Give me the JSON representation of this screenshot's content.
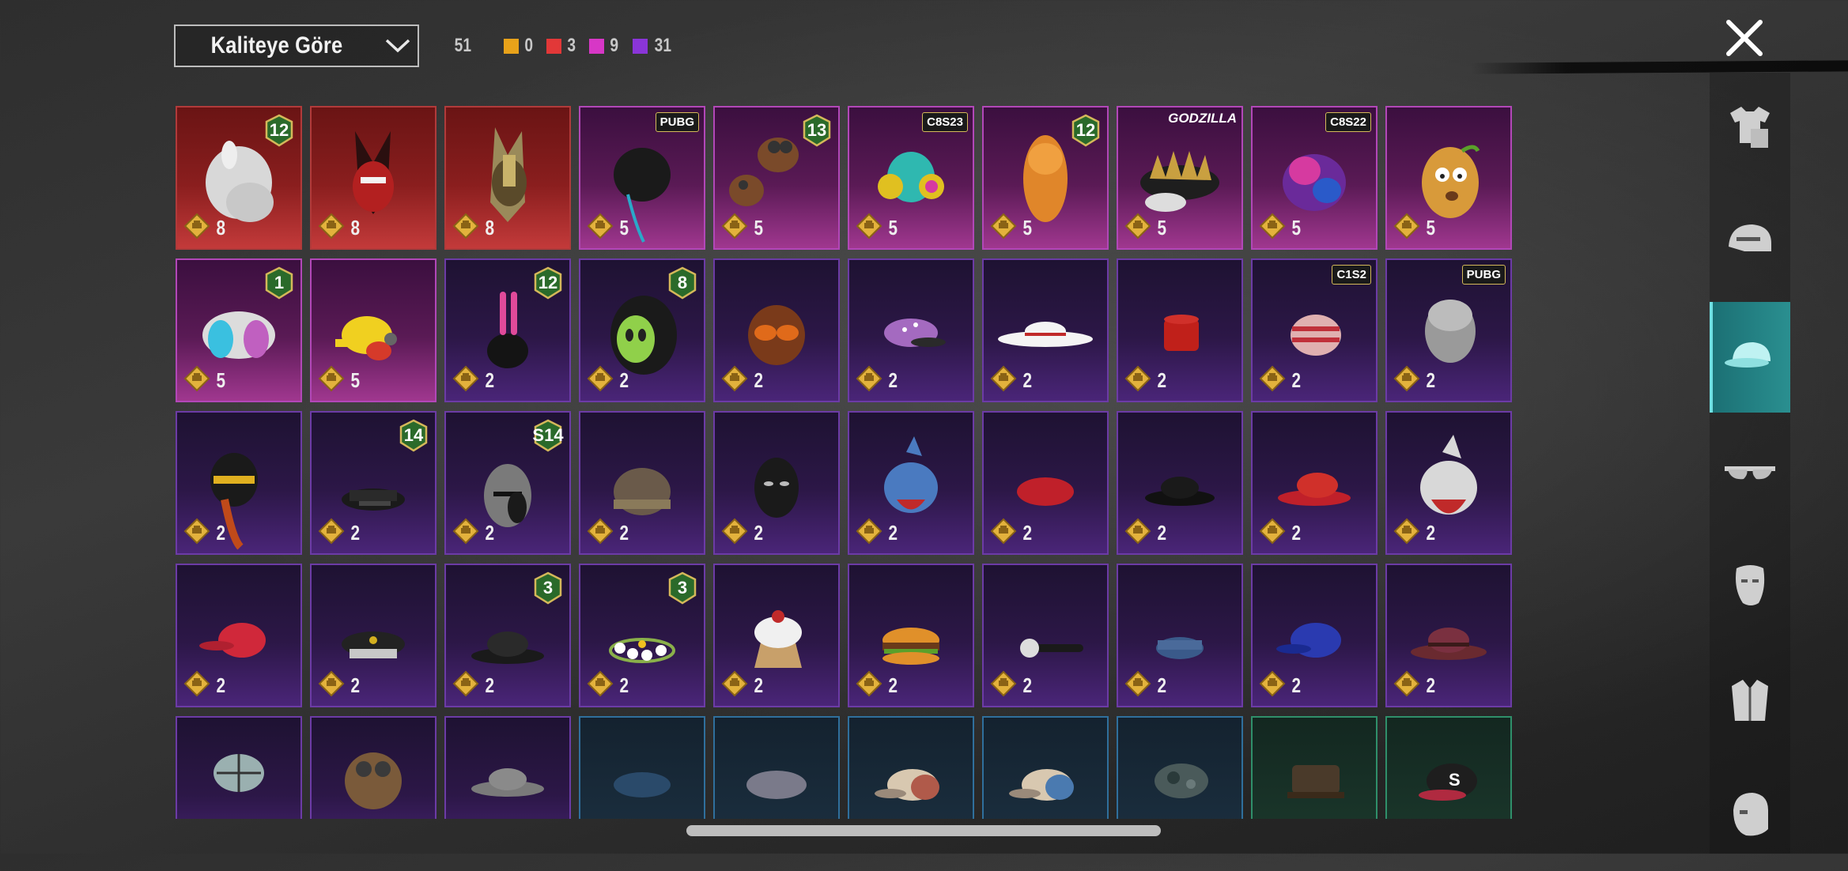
{
  "sort": {
    "label": "Kaliteye Göre"
  },
  "counts": {
    "total": "51",
    "items": [
      {
        "color": "#e8a21a",
        "value": "0"
      },
      {
        "color": "#e23838",
        "value": "3"
      },
      {
        "color": "#d737c6",
        "value": "9"
      },
      {
        "color": "#8a35d8",
        "value": "31"
      }
    ]
  },
  "categories": [
    {
      "name": "outfit-icon",
      "active": false
    },
    {
      "name": "helmet-icon",
      "active": false
    },
    {
      "name": "cap-icon",
      "active": true
    },
    {
      "name": "glasses-icon",
      "active": false
    },
    {
      "name": "mask-icon",
      "active": false
    },
    {
      "name": "jacket-icon",
      "active": false
    },
    {
      "name": "face-icon",
      "active": false
    }
  ],
  "items": [
    {
      "rarity": "legendary",
      "qty": "8",
      "badge": "12",
      "art": "white-hair"
    },
    {
      "rarity": "legendary",
      "qty": "8",
      "badge": "",
      "art": "red-mask"
    },
    {
      "rarity": "legendary",
      "qty": "8",
      "badge": "",
      "art": "anubis"
    },
    {
      "rarity": "mythic-pink",
      "qty": "5",
      "tag": "PUBG",
      "art": "dark-hair"
    },
    {
      "rarity": "mythic-pink",
      "qty": "5",
      "badge": "13",
      "art": "goggles-hair"
    },
    {
      "rarity": "mythic-pink",
      "qty": "5",
      "tag": "C8S23",
      "art": "headphones"
    },
    {
      "rarity": "mythic-pink",
      "qty": "5",
      "badge": "12",
      "art": "orange-hair"
    },
    {
      "rarity": "mythic-pink",
      "qty": "5",
      "word": "GODZILLA",
      "art": "spike-cap"
    },
    {
      "rarity": "mythic-pink",
      "qty": "5",
      "tag": "C8S22",
      "art": "purple-hair"
    },
    {
      "rarity": "mythic-pink",
      "qty": "5",
      "badge": "",
      "art": "potato"
    },
    {
      "rarity": "mythic-pink",
      "qty": "5",
      "badge": "1",
      "art": "blue-hair"
    },
    {
      "rarity": "mythic-pink",
      "qty": "5",
      "badge": "",
      "art": "duck-cap"
    },
    {
      "rarity": "epic",
      "qty": "2",
      "badge": "12",
      "art": "bunny-helmet"
    },
    {
      "rarity": "epic",
      "qty": "2",
      "badge": "8",
      "art": "alien-hood"
    },
    {
      "rarity": "epic",
      "qty": "2",
      "badge": "",
      "art": "sunglasses-hair"
    },
    {
      "rarity": "epic",
      "qty": "2",
      "badge": "",
      "art": "dotted-cap"
    },
    {
      "rarity": "epic",
      "qty": "2",
      "badge": "",
      "art": "sun-hat"
    },
    {
      "rarity": "epic",
      "qty": "2",
      "badge": "",
      "art": "fez"
    },
    {
      "rarity": "epic",
      "qty": "2",
      "tag": "C1S2",
      "art": "striped-hat"
    },
    {
      "rarity": "epic",
      "qty": "2",
      "tag": "PUBG",
      "art": "grey-hair"
    },
    {
      "rarity": "epic",
      "qty": "2",
      "badge": "",
      "art": "black-helmet"
    },
    {
      "rarity": "epic",
      "qty": "2",
      "badge": "14",
      "art": "officer-cap"
    },
    {
      "rarity": "epic",
      "qty": "2",
      "badge": "S14",
      "art": "knight-helmet"
    },
    {
      "rarity": "epic",
      "qty": "2",
      "badge": "",
      "art": "beanie"
    },
    {
      "rarity": "epic",
      "qty": "2",
      "badge": "",
      "art": "panther-mask"
    },
    {
      "rarity": "epic",
      "qty": "2",
      "badge": "",
      "art": "shark-hood"
    },
    {
      "rarity": "epic",
      "qty": "2",
      "badge": "",
      "art": "red-beret"
    },
    {
      "rarity": "epic",
      "qty": "2",
      "badge": "",
      "art": "black-fedora"
    },
    {
      "rarity": "epic",
      "qty": "2",
      "badge": "",
      "art": "red-fedora"
    },
    {
      "rarity": "epic",
      "qty": "2",
      "badge": "",
      "art": "white-shark"
    },
    {
      "rarity": "epic",
      "qty": "2",
      "badge": "",
      "art": "red-cap"
    },
    {
      "rarity": "epic",
      "qty": "2",
      "badge": "",
      "art": "police-cap"
    },
    {
      "rarity": "epic",
      "qty": "2",
      "badge": "3",
      "art": "black-hat"
    },
    {
      "rarity": "epic",
      "qty": "2",
      "badge": "3",
      "art": "flower-crown"
    },
    {
      "rarity": "epic",
      "qty": "2",
      "badge": "",
      "art": "cupcake-hat"
    },
    {
      "rarity": "epic",
      "qty": "2",
      "badge": "",
      "art": "burger-hat"
    },
    {
      "rarity": "epic",
      "qty": "2",
      "badge": "",
      "art": "headlamp"
    },
    {
      "rarity": "epic",
      "qty": "2",
      "badge": "",
      "art": "blue-cap-sailor"
    },
    {
      "rarity": "epic",
      "qty": "2",
      "badge": "",
      "art": "blue-cap"
    },
    {
      "rarity": "epic",
      "qty": "2",
      "badge": "",
      "art": "maroon-fedora"
    },
    {
      "rarity": "epic",
      "qty": "",
      "badge": "",
      "art": "checkered-cap"
    },
    {
      "rarity": "epic",
      "qty": "",
      "badge": "",
      "art": "aviator"
    },
    {
      "rarity": "epic",
      "qty": "",
      "badge": "",
      "art": "grey-fedora"
    },
    {
      "rarity": "rare",
      "qty": "",
      "badge": "",
      "art": "blue-beret"
    },
    {
      "rarity": "rare",
      "qty": "",
      "badge": "",
      "art": "grey-beret"
    },
    {
      "rarity": "rare",
      "qty": "",
      "badge": "",
      "art": "trucker-red"
    },
    {
      "rarity": "rare",
      "qty": "",
      "badge": "",
      "art": "trucker-blue"
    },
    {
      "rarity": "rare",
      "qty": "",
      "badge": "",
      "art": "camo-cap"
    },
    {
      "rarity": "uncommon",
      "qty": "",
      "badge": "",
      "art": "military-cap"
    },
    {
      "rarity": "uncommon",
      "qty": "",
      "badge": "",
      "art": "s-cap"
    }
  ]
}
